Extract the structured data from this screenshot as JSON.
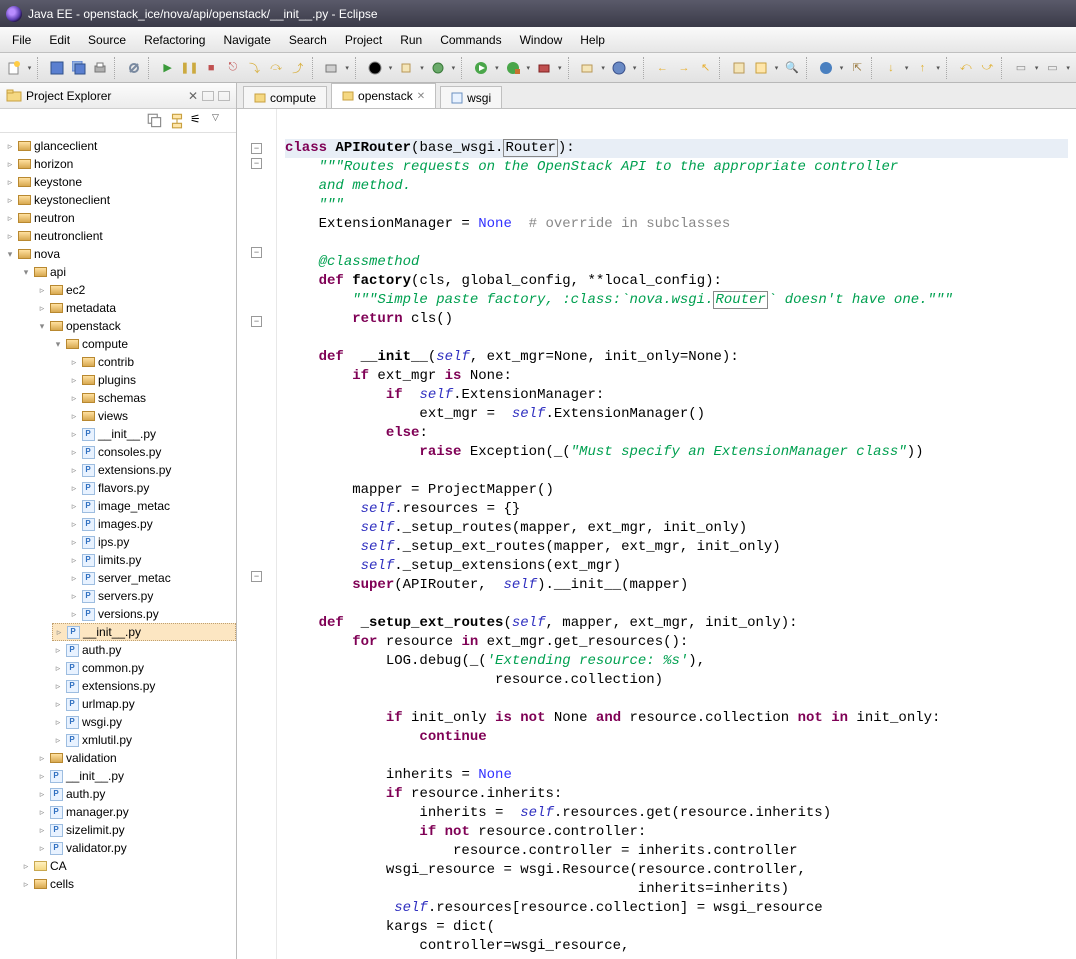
{
  "window": {
    "title": "Java EE - openstack_ice/nova/api/openstack/__init__.py - Eclipse"
  },
  "menu": [
    "File",
    "Edit",
    "Source",
    "Refactoring",
    "Navigate",
    "Search",
    "Project",
    "Run",
    "Commands",
    "Window",
    "Help"
  ],
  "projectExplorer": {
    "title": "Project Explorer"
  },
  "tree": {
    "roots": [
      {
        "label": "glanceclient",
        "icon": "pkg"
      },
      {
        "label": "horizon",
        "icon": "pkg"
      },
      {
        "label": "keystone",
        "icon": "pkg"
      },
      {
        "label": "keystoneclient",
        "icon": "pkg"
      },
      {
        "label": "neutron",
        "icon": "pkg"
      },
      {
        "label": "neutronclient",
        "icon": "pkg"
      }
    ],
    "nova": "nova",
    "api": "api",
    "apiChildren": [
      {
        "label": "ec2",
        "icon": "pkg"
      },
      {
        "label": "metadata",
        "icon": "pkg"
      }
    ],
    "openstack": "openstack",
    "compute": "compute",
    "computeChildren": [
      {
        "label": "contrib",
        "icon": "pkg"
      },
      {
        "label": "plugins",
        "icon": "pkg"
      },
      {
        "label": "schemas",
        "icon": "pkg"
      },
      {
        "label": "views",
        "icon": "pkg"
      },
      {
        "label": "__init__.py",
        "icon": "py"
      },
      {
        "label": "consoles.py",
        "icon": "py"
      },
      {
        "label": "extensions.py",
        "icon": "py"
      },
      {
        "label": "flavors.py",
        "icon": "py"
      },
      {
        "label": "image_metac",
        "icon": "py"
      },
      {
        "label": "images.py",
        "icon": "py"
      },
      {
        "label": "ips.py",
        "icon": "py"
      },
      {
        "label": "limits.py",
        "icon": "py"
      },
      {
        "label": "server_metac",
        "icon": "py"
      },
      {
        "label": "servers.py",
        "icon": "py"
      },
      {
        "label": "versions.py",
        "icon": "py"
      }
    ],
    "openstackRest": [
      {
        "label": "__init__.py",
        "icon": "py",
        "sel": true
      },
      {
        "label": "auth.py",
        "icon": "py"
      },
      {
        "label": "common.py",
        "icon": "py"
      },
      {
        "label": "extensions.py",
        "icon": "py"
      },
      {
        "label": "urlmap.py",
        "icon": "py"
      },
      {
        "label": "wsgi.py",
        "icon": "py"
      },
      {
        "label": "xmlutil.py",
        "icon": "py"
      }
    ],
    "apiRest": [
      {
        "label": "validation",
        "icon": "pkg"
      },
      {
        "label": "__init__.py",
        "icon": "py"
      },
      {
        "label": "auth.py",
        "icon": "py"
      },
      {
        "label": "manager.py",
        "icon": "py"
      },
      {
        "label": "sizelimit.py",
        "icon": "py"
      },
      {
        "label": "validator.py",
        "icon": "py"
      }
    ],
    "novaRest": [
      {
        "label": "CA",
        "icon": "folder"
      },
      {
        "label": "cells",
        "icon": "pkg"
      }
    ]
  },
  "tabs": [
    {
      "label": "compute",
      "active": false
    },
    {
      "label": "openstack",
      "active": true,
      "close": true
    },
    {
      "label": "wsgi",
      "active": false
    }
  ],
  "c": {
    "class": "class",
    "def": "def",
    "return": "return",
    "if": "if",
    "else": "else",
    "for": "for",
    "in": "in",
    "is": "is",
    "not": "not",
    "and": "and",
    "raise": "raise",
    "continue": "continue",
    "super": "super",
    "apirouter": "APIRouter",
    "basewsgi": "(base_wsgi.",
    "router": "Router",
    "rparencolon": "):",
    "doc1": "\"\"\"Routes requests on the OpenStack API to the appropriate controller",
    "doc2": "and method.",
    "doc3": "\"\"\"",
    "ext": "ExtensionManager = ",
    "none": "None",
    "cm1": "  # override in subclasses",
    "cmethod": "@classmethod",
    "factorysig": " factory(cls, global_config, **local_config):",
    "doc4": "\"\"\"Simple paste factory, :class:`nova.wsgi.",
    "doc4b": "` doesn't have one.\"\"\"",
    "retcls": " cls()",
    "initsig": " __init__",
    "initargs": "(self",
    "initrest": ", ext_mgr=None, init_only=None):",
    "l1": " ext_mgr ",
    "isnone": " None:",
    "l2": " self",
    "l2b": ".ExtensionManager:",
    "l3": "ext_mgr = ",
    "l3b": ".ExtensionManager()",
    "elsec": ":",
    "raise1": " Exception(_(",
    "raise1str": "\"Must specify an ExtensionManager class\"",
    "raise1e": "))",
    "m1": "mapper = ProjectMapper()",
    "m2": ".resources = {}",
    "m3": "._setup_routes(mapper, ext_mgr, init_only)",
    "m4": "._setup_ext_routes(mapper, ext_mgr, init_only)",
    "m5": "._setup_extensions(ext_mgr)",
    "m6": "(APIRouter, ",
    "m6b": ").__init__(mapper)",
    "setupsig": " _setup_ext_routes",
    "setupargs": "(self",
    "setuprest": ", mapper, ext_mgr, init_only):",
    "for1": " resource ",
    "for1b": " ext_mgr.get_resources():",
    "log": "LOG.debug(_(",
    "logstr": "'Extending resource: %s'",
    "loge": "),",
    "log2": "resource.collection)",
    "if2": " init_only ",
    "if2nn": " None ",
    "if2c": " resource.collection ",
    "if2d": " init_only:",
    "inh": "inherits = ",
    "if3": " resource.inherits:",
    "inh2": "inherits = ",
    "inh2b": ".resources.get(resource.inherits)",
    "if4": " resource.controller:",
    "ctrl": "resource.controller = inherits.controller",
    "wsgi": "wsgi_resource = wsgi.Resource(resource.controller,",
    "wsgib": "inherits=inherits)",
    "res": ".resources[resource.collection] = wsgi_resource",
    "kargs": "kargs = dict(",
    "kargsb": "controller=wsgi_resource,"
  }
}
